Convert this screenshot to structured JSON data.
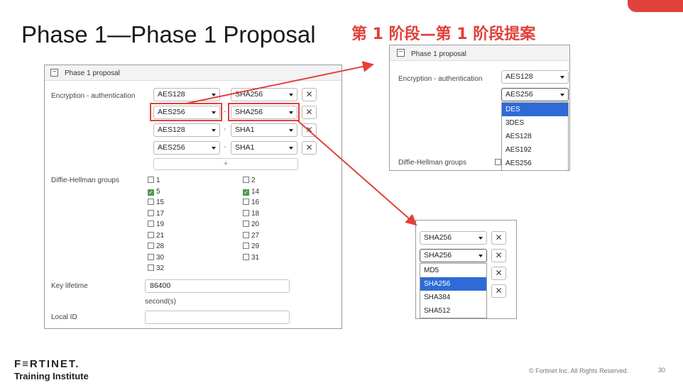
{
  "slide": {
    "title": "Phase 1—Phase 1 Proposal",
    "subtitle": "第 1 阶段—第 1 阶段提案",
    "accent_color": "#e0413a"
  },
  "main_panel": {
    "header_title": "Phase 1 proposal",
    "collapse_symbol": "−",
    "enc_auth_label": "Encryption - authentication",
    "proposals": [
      {
        "encryption": "AES128",
        "authentication": "SHA256"
      },
      {
        "encryption": "AES256",
        "authentication": "SHA256"
      },
      {
        "encryption": "AES128",
        "authentication": "SHA1"
      },
      {
        "encryption": "AES256",
        "authentication": "SHA1"
      }
    ],
    "separator": "-",
    "remove_symbol": "✕",
    "add_symbol": "+",
    "dh_label": "Diffie-Hellman groups",
    "dh_groups": [
      {
        "value": "1",
        "checked": false
      },
      {
        "value": "2",
        "checked": false
      },
      {
        "value": "5",
        "checked": true
      },
      {
        "value": "14",
        "checked": true
      },
      {
        "value": "15",
        "checked": false
      },
      {
        "value": "16",
        "checked": false
      },
      {
        "value": "17",
        "checked": false
      },
      {
        "value": "18",
        "checked": false
      },
      {
        "value": "19",
        "checked": false
      },
      {
        "value": "20",
        "checked": false
      },
      {
        "value": "21",
        "checked": false
      },
      {
        "value": "27",
        "checked": false
      },
      {
        "value": "28",
        "checked": false
      },
      {
        "value": "29",
        "checked": false
      },
      {
        "value": "30",
        "checked": false
      },
      {
        "value": "31",
        "checked": false
      },
      {
        "value": "32",
        "checked": false
      }
    ],
    "check_mark": "✓",
    "key_lifetime_label": "Key lifetime",
    "key_lifetime_value": "86400",
    "key_lifetime_unit": "second(s)",
    "local_id_label": "Local ID",
    "local_id_value": ""
  },
  "encryption_zoom": {
    "header_title": "Phase 1 proposal",
    "enc_auth_label": "Encryption - authentication",
    "first_select": "AES128",
    "open_select": "AES256",
    "options": [
      "DES",
      "3DES",
      "AES128",
      "AES192",
      "AES256"
    ],
    "highlighted_option": "DES",
    "dh_label": "Diffie-Hellman groups"
  },
  "auth_zoom": {
    "first_select": "SHA256",
    "open_select": "SHA256",
    "options": [
      "MD5",
      "SHA256",
      "SHA384",
      "SHA512"
    ],
    "highlighted_option": "SHA256"
  },
  "footer": {
    "brand": "F≡RTINET.",
    "brand_sub": "Training Institute",
    "copyright": "© Fortinet Inc. All Rights Reserved.",
    "page_number": "30"
  }
}
